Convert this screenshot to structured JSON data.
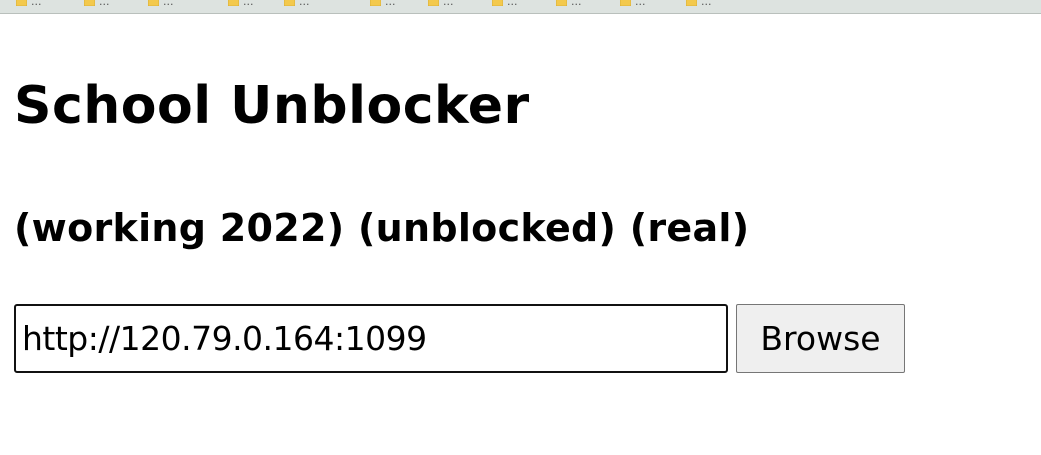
{
  "bookmarks_bar": {
    "items": [
      {
        "label": "...",
        "icon": "folder-icon"
      },
      {
        "label": "...",
        "icon": "folder-icon"
      },
      {
        "label": "...",
        "icon": "folder-icon"
      },
      {
        "label": "...",
        "icon": "folder-icon"
      },
      {
        "label": "...",
        "icon": "folder-icon"
      },
      {
        "label": "...",
        "icon": "folder-icon"
      },
      {
        "label": "...",
        "icon": "folder-icon"
      },
      {
        "label": "...",
        "icon": "folder-icon"
      },
      {
        "label": "...",
        "icon": "folder-icon"
      },
      {
        "label": "...",
        "icon": "folder-icon"
      },
      {
        "label": "...",
        "icon": "folder-icon"
      }
    ]
  },
  "page": {
    "title": "School Unblocker",
    "subtitle": "(working 2022) (unblocked) (real)"
  },
  "form": {
    "url_value": "http://120.79.0.164:1099",
    "browse_label": "Browse"
  },
  "colors": {
    "background": "#ffffff",
    "bookmarks_bar": "#dde3e0",
    "folder": "#f3c94d",
    "button": "#efefef"
  }
}
